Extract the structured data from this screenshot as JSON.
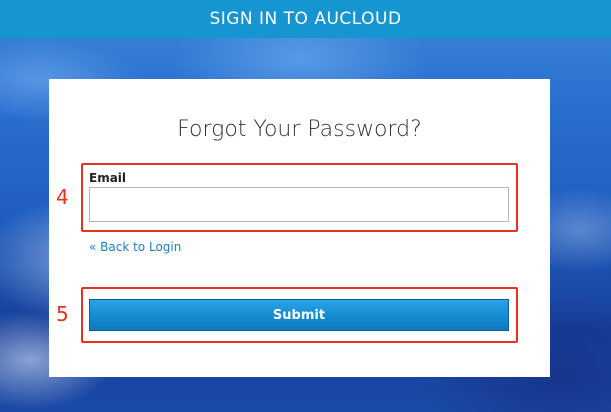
{
  "header": {
    "title": "SIGN IN TO AUCLOUD"
  },
  "form": {
    "title": "Forgot Your Password?",
    "email_label": "Email",
    "email_value": "",
    "back_link": "« Back to Login",
    "submit_label": "Submit"
  },
  "annotations": [
    {
      "number": "4",
      "target": "email-field"
    },
    {
      "number": "5",
      "target": "submit-button"
    }
  ],
  "colors": {
    "header_bg": "#1596d1",
    "link": "#1a7fc0",
    "button_bg": "#168bd0",
    "callout": "#e8321f"
  }
}
